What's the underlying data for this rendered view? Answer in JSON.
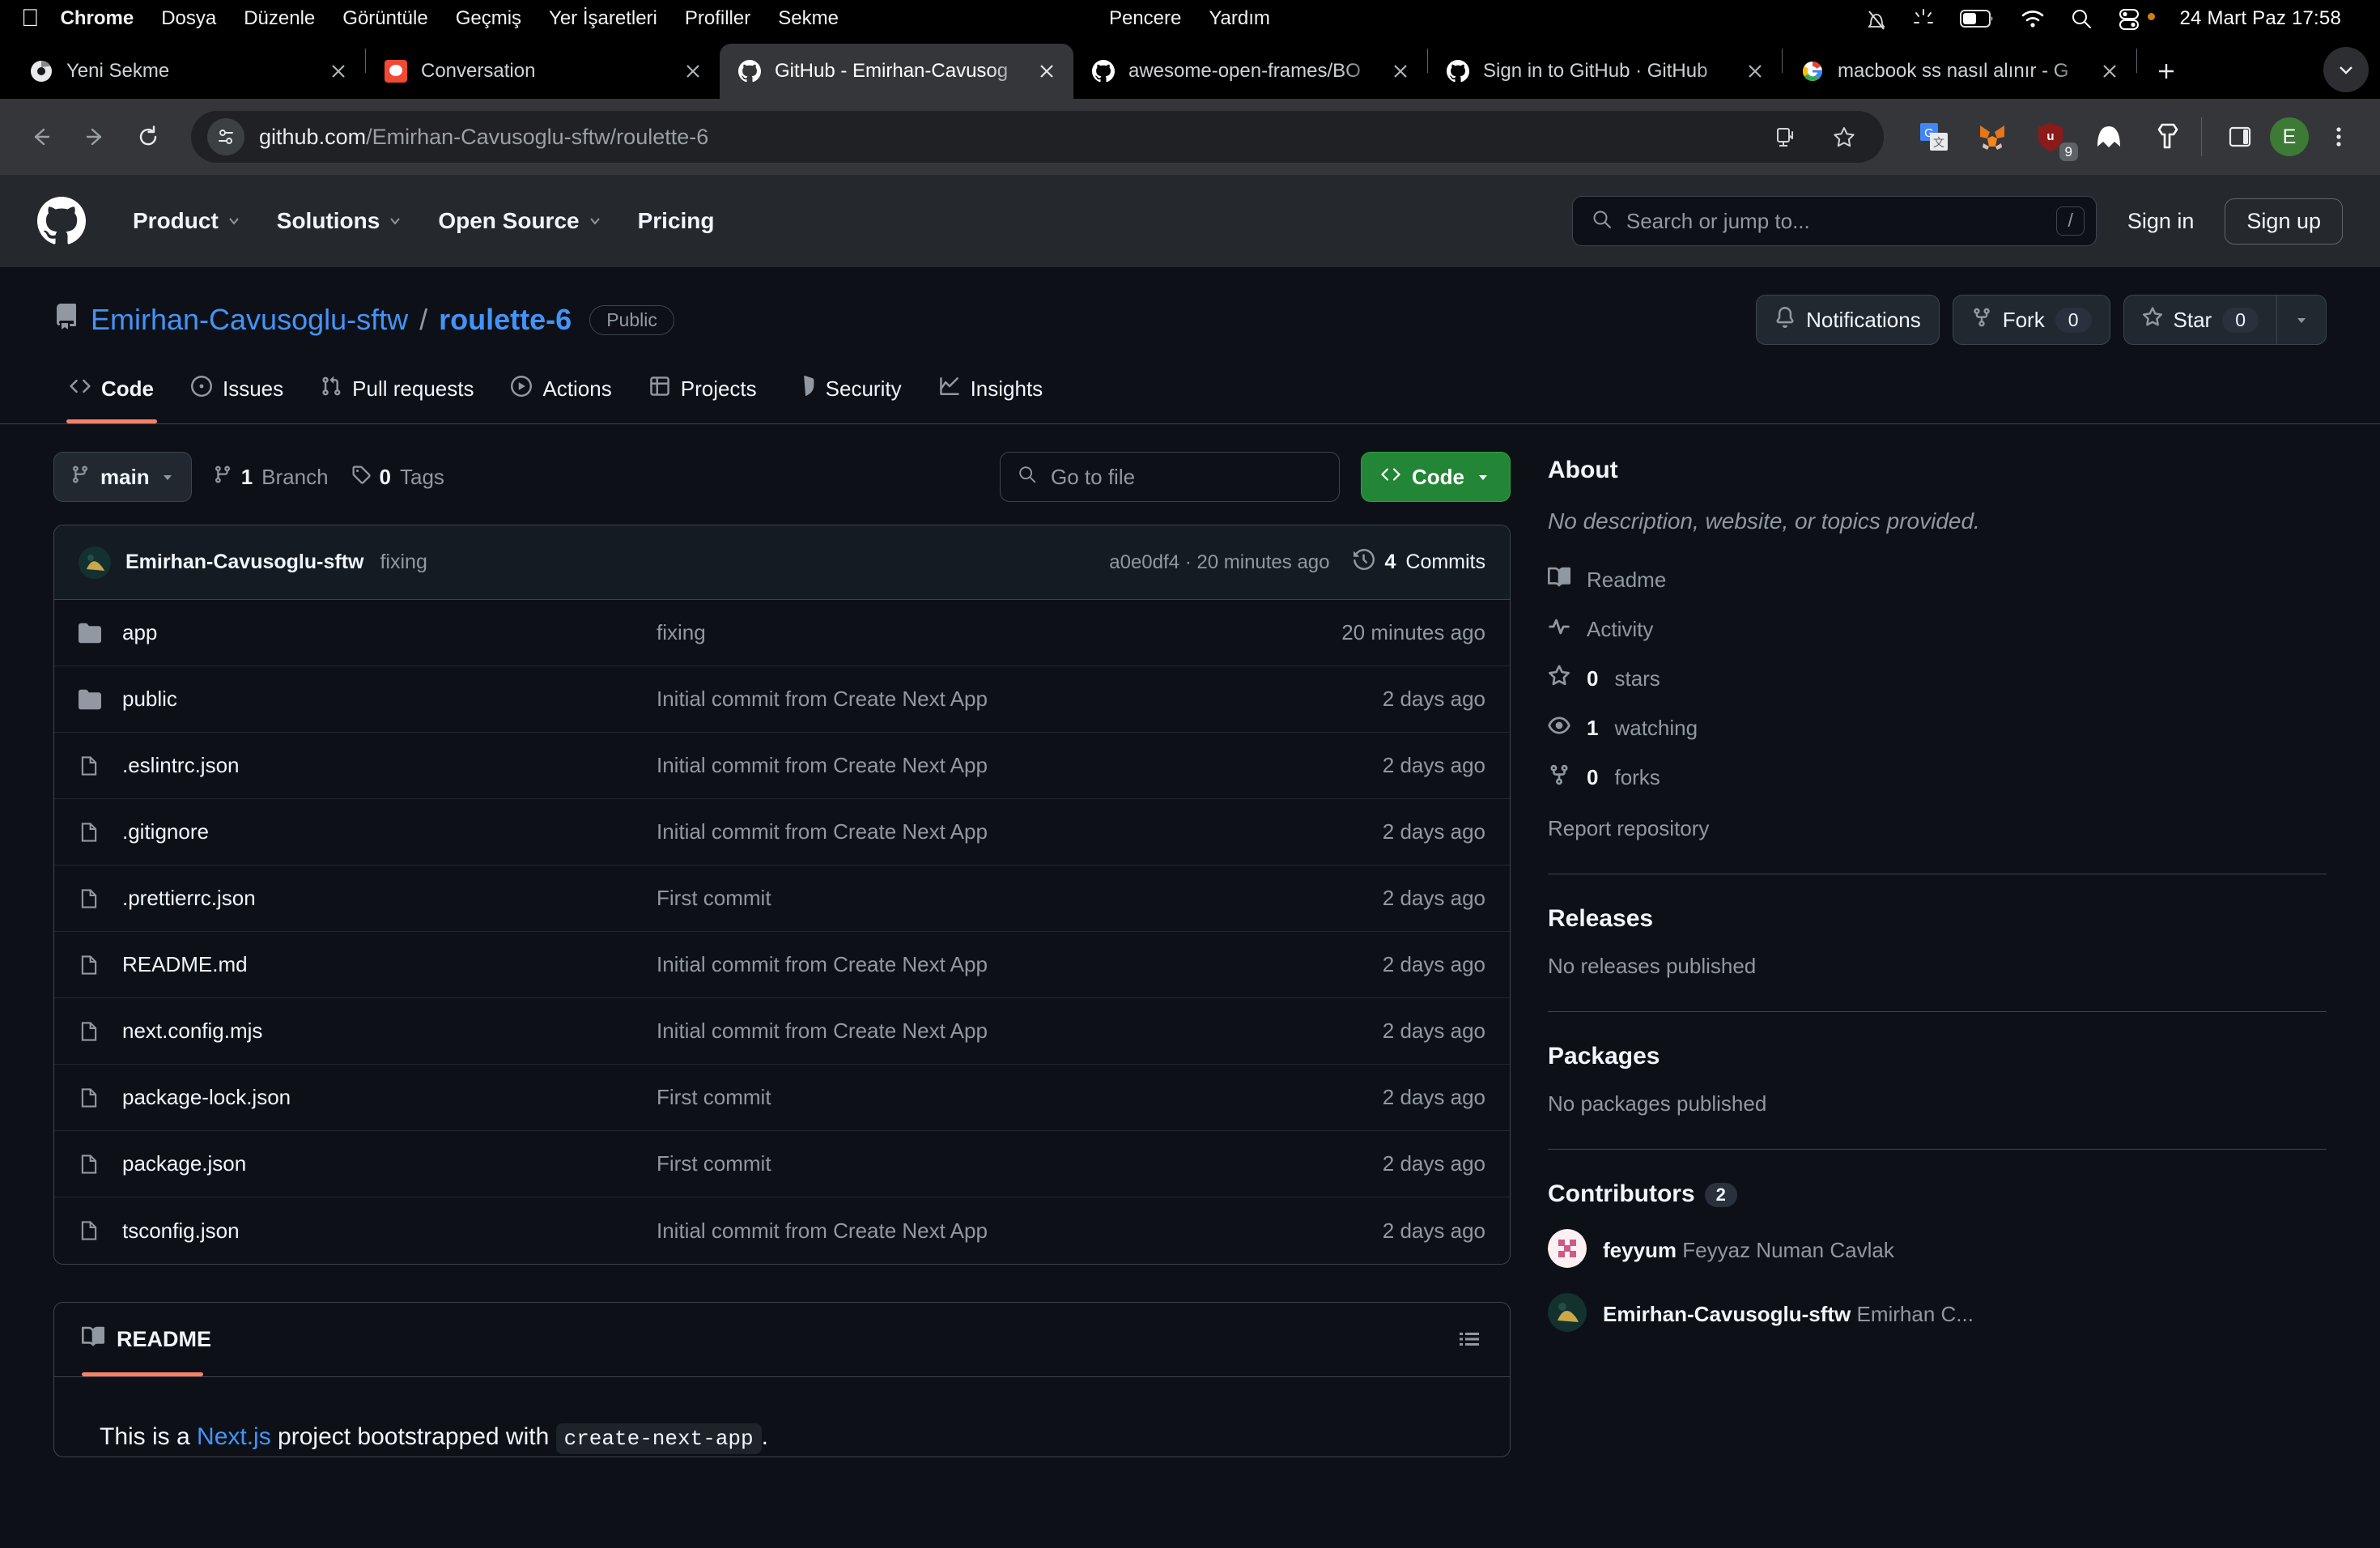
{
  "macos": {
    "apple_menu": "apple-logo",
    "menus": [
      "Chrome",
      "Dosya",
      "Düzenle",
      "Görüntüle",
      "Geçmiş",
      "Yer İşaretleri",
      "Profiller",
      "Sekme"
    ],
    "right_menus": [
      "Pencere",
      "Yardım"
    ],
    "status_icons": [
      "do-not-disturb-icon",
      "brightness-icon",
      "battery-icon",
      "wifi-icon",
      "search-icon",
      "control-center-icon"
    ],
    "clock": "24 Mart Paz  17:58"
  },
  "browser": {
    "tabs": [
      {
        "title": "Yeni Sekme",
        "favicon": "chrome-icon",
        "active": false
      },
      {
        "title": "Conversation",
        "favicon": "claude-icon",
        "active": false
      },
      {
        "title": "GitHub - Emirhan-Cavusog",
        "favicon": "github-icon",
        "active": true
      },
      {
        "title": "awesome-open-frames/BO",
        "favicon": "github-icon",
        "active": false
      },
      {
        "title": "Sign in to GitHub · GitHub",
        "favicon": "github-icon",
        "active": false
      },
      {
        "title": "macbook ss nasıl alınır - G",
        "favicon": "google-icon",
        "active": false
      }
    ],
    "new_tab_label": "+",
    "url_host": "github.com",
    "url_path": "/Emirhan-Cavusoglu-sftw/roulette-6",
    "extensions": [
      "google-translate-icon",
      "metamask-icon",
      "ublock-origin-icon",
      "malwarebytes-icon",
      "keeper-icon"
    ],
    "ublock_badge": "9",
    "profile_initial": "E"
  },
  "github": {
    "header": {
      "nav": [
        "Product",
        "Solutions",
        "Open Source",
        "Pricing"
      ],
      "nav_has_caret": [
        true,
        true,
        true,
        false
      ],
      "search_placeholder": "Search or jump to...",
      "search_shortcut": "/",
      "sign_in": "Sign in",
      "sign_up": "Sign up"
    },
    "repo": {
      "owner": "Emirhan-Cavusoglu-sftw",
      "separator": "/",
      "name": "roulette-6",
      "visibility": "Public",
      "notifications_label": "Notifications",
      "fork_label": "Fork",
      "fork_count": "0",
      "star_label": "Star",
      "star_count": "0"
    },
    "tabs": [
      {
        "label": "Code",
        "icon": "code-icon",
        "active": true
      },
      {
        "label": "Issues",
        "icon": "issue-opened-icon",
        "active": false
      },
      {
        "label": "Pull requests",
        "icon": "git-pull-request-icon",
        "active": false
      },
      {
        "label": "Actions",
        "icon": "play-icon",
        "active": false
      },
      {
        "label": "Projects",
        "icon": "table-icon",
        "active": false
      },
      {
        "label": "Security",
        "icon": "shield-icon",
        "active": false
      },
      {
        "label": "Insights",
        "icon": "graph-icon",
        "active": false
      }
    ],
    "filebar": {
      "branch": "main",
      "branch_count": "1",
      "branch_label": "Branch",
      "tag_count": "0",
      "tag_label": "Tags",
      "go_to_file_placeholder": "Go to file",
      "code_button": "Code"
    },
    "latest_commit": {
      "author": "Emirhan-Cavusoglu-sftw",
      "message": "fixing",
      "sha": "a0e0df4",
      "separator": "·",
      "time": "20 minutes ago",
      "commits_count": "4",
      "commits_label": "Commits"
    },
    "files": [
      {
        "name": "app",
        "type": "folder",
        "commit": "fixing",
        "time": "20 minutes ago"
      },
      {
        "name": "public",
        "type": "folder",
        "commit": "Initial commit from Create Next App",
        "time": "2 days ago"
      },
      {
        "name": ".eslintrc.json",
        "type": "file",
        "commit": "Initial commit from Create Next App",
        "time": "2 days ago"
      },
      {
        "name": ".gitignore",
        "type": "file",
        "commit": "Initial commit from Create Next App",
        "time": "2 days ago"
      },
      {
        "name": ".prettierrc.json",
        "type": "file",
        "commit": "First commit",
        "time": "2 days ago"
      },
      {
        "name": "README.md",
        "type": "file",
        "commit": "Initial commit from Create Next App",
        "time": "2 days ago"
      },
      {
        "name": "next.config.mjs",
        "type": "file",
        "commit": "Initial commit from Create Next App",
        "time": "2 days ago"
      },
      {
        "name": "package-lock.json",
        "type": "file",
        "commit": "First commit",
        "time": "2 days ago"
      },
      {
        "name": "package.json",
        "type": "file",
        "commit": "First commit",
        "time": "2 days ago"
      },
      {
        "name": "tsconfig.json",
        "type": "file",
        "commit": "Initial commit from Create Next App",
        "time": "2 days ago"
      }
    ],
    "readme": {
      "tab_label": "README",
      "text_before": "This is a ",
      "link_text": "Next.js",
      "text_middle": " project bootstrapped with ",
      "code_text": "create-next-app",
      "text_after": "."
    },
    "sidebar": {
      "about_title": "About",
      "about_description": "No description, website, or topics provided.",
      "links": [
        {
          "label": "Readme",
          "icon": "book-icon",
          "bold_prefix": ""
        },
        {
          "label": "Activity",
          "icon": "pulse-icon",
          "bold_prefix": ""
        },
        {
          "label": "stars",
          "icon": "star-icon",
          "bold_prefix": "0"
        },
        {
          "label": "watching",
          "icon": "eye-icon",
          "bold_prefix": "1"
        },
        {
          "label": "forks",
          "icon": "fork-icon",
          "bold_prefix": "0"
        }
      ],
      "report": "Report repository",
      "releases_title": "Releases",
      "releases_empty": "No releases published",
      "packages_title": "Packages",
      "packages_empty": "No packages published",
      "contributors_title": "Contributors",
      "contributors_count": "2",
      "contributors": [
        {
          "username": "feyyum",
          "fullname": "Feyyaz Numan Cavlak"
        },
        {
          "username": "Emirhan-Cavusoglu-sftw",
          "fullname": "Emirhan C..."
        }
      ]
    }
  },
  "colors": {
    "accent_blue": "#4493f8",
    "accent_green": "#238636",
    "accent_orange": "#f78166",
    "page_bg": "#0d1117",
    "header_bg": "#25292e"
  }
}
